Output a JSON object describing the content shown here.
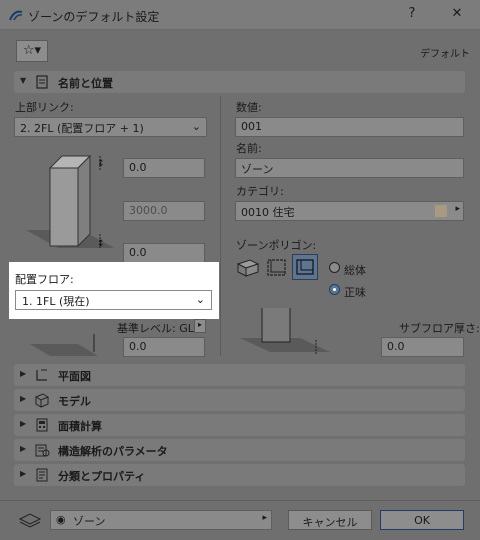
{
  "window": {
    "title": "ゾーンのデフォルト設定",
    "help_label": "?",
    "close_label": "✕"
  },
  "toolbar": {
    "star_label": "☆▾",
    "default_label": "デフォルト"
  },
  "sections": {
    "name_location": "名前と位置",
    "floor_plan": "平面図",
    "model": "モデル",
    "area_calc": "面積計算",
    "structural": "構造解析のパラメータ",
    "classification": "分類とプロパティ"
  },
  "left": {
    "top_link_label": "上部リンク:",
    "top_link_value": "2. 2FL (配置フロア + 1)",
    "top_offset": "0.0",
    "height": "3000.0",
    "bottom_offset": "0.0",
    "home_floor_label": "配置フロア:",
    "home_floor_value": "1. 1FL (現在)",
    "ref_level_label": "基準レベル: GL",
    "ref_level_value": "0.0"
  },
  "right": {
    "number_label": "数値:",
    "number_value": "001",
    "name_label": "名前:",
    "name_value": "ゾーン",
    "category_label": "カテゴリ:",
    "category_value": "0010  住宅",
    "polygon_label": "ゾーンポリゴン:",
    "radio_gross": "総体",
    "radio_net": "正味",
    "subfloor_label": "サブフロア厚さ:",
    "subfloor_value": "0.0"
  },
  "footer": {
    "layer_value": "ゾーン",
    "cancel_label": "キャンセル",
    "ok_label": "OK"
  }
}
